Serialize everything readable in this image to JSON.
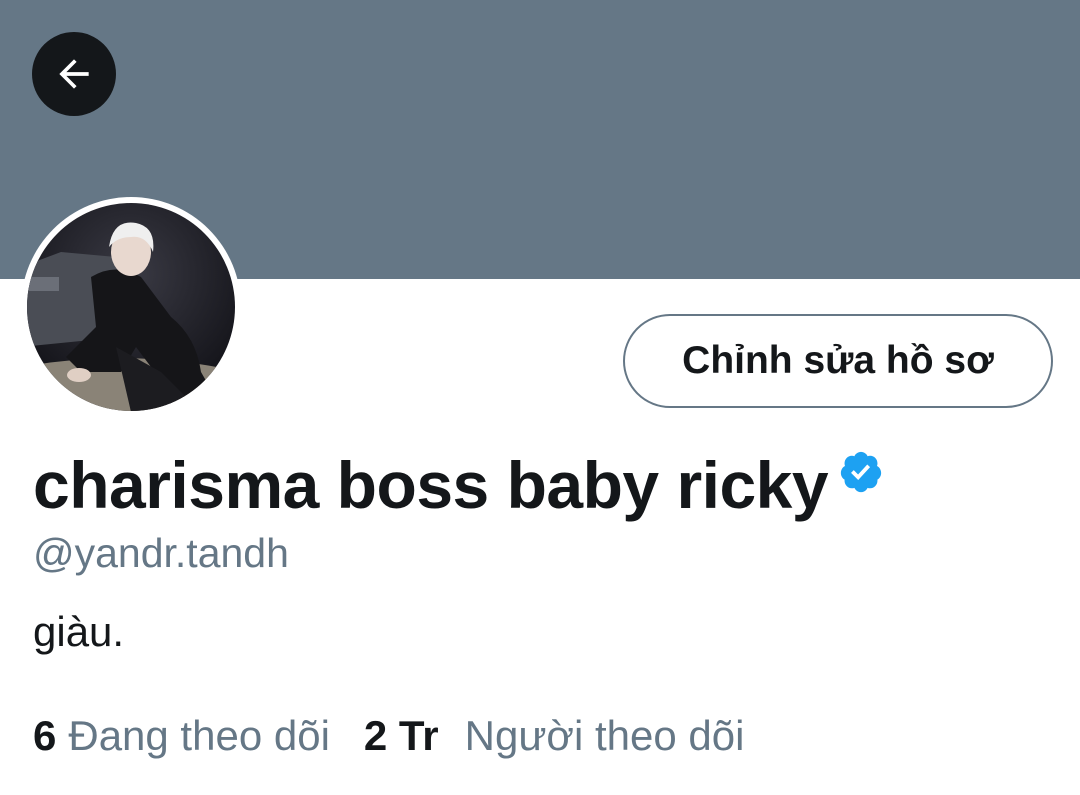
{
  "colors": {
    "banner": "#657786",
    "primary_text": "#14171a",
    "secondary_text": "#657786",
    "verified": "#1da1f2"
  },
  "header": {
    "back_icon": "arrow-left-icon"
  },
  "profile": {
    "edit_button_label": "Chỉnh sửa hồ sơ",
    "display_name": "charisma boss baby ricky",
    "verified_icon": "verified-badge-icon",
    "handle": "@yandr.tandh",
    "bio": "giàu."
  },
  "stats": {
    "following_count": "6",
    "following_label": "Đang theo dõi",
    "followers_count": "2 Tr",
    "followers_label": "Người theo dõi"
  }
}
